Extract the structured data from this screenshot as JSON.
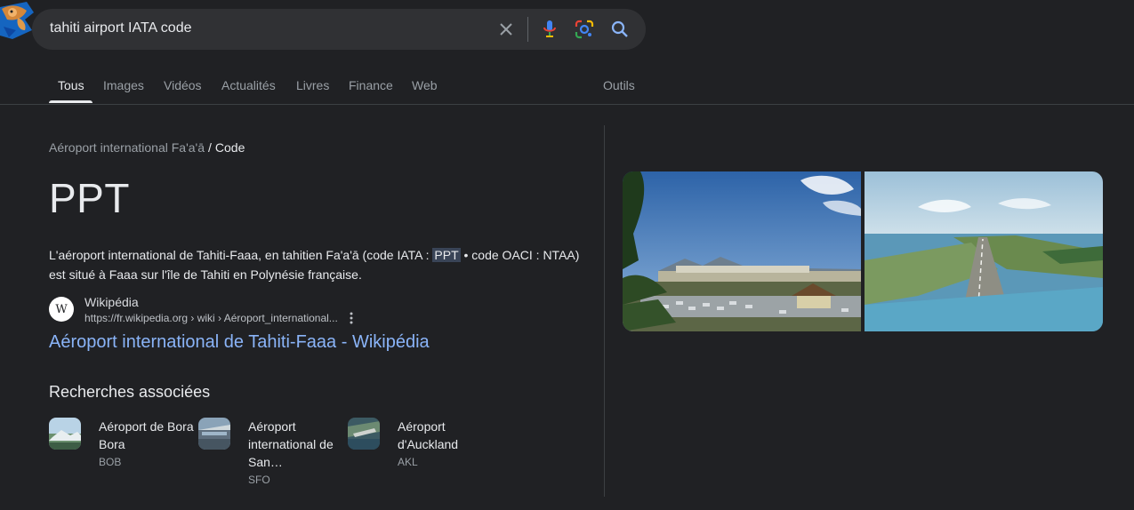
{
  "search": {
    "query": "tahiti airport IATA code"
  },
  "tabs": [
    "Tous",
    "Images",
    "Vidéos",
    "Actualités",
    "Livres",
    "Finance",
    "Web"
  ],
  "tools_label": "Outils",
  "breadcrumb": {
    "parent": "Aéroport international Fa'a'ā",
    "separator": "/",
    "current": "Code"
  },
  "answer": "PPT",
  "snippet": {
    "before": "L'aéroport international de Tahiti-Faaa, en tahitien Fa'a'ā (code IATA : ",
    "highlight": "PPT",
    "after_line1": " • code OACI : NTAA)",
    "line2": "est situé à Faaa sur l'île de Tahiti en Polynésie française."
  },
  "source": {
    "logo_letter": "W",
    "name": "Wikipédia",
    "url": "https://fr.wikipedia.org › wiki › Aéroport_international..."
  },
  "result_title": "Aéroport international de Tahiti-Faaa - Wikipédia",
  "related": {
    "title": "Recherches associées",
    "items": [
      {
        "name": "Aéroport de Bora Bora",
        "code": "BOB"
      },
      {
        "name": "Aéroport international de San…",
        "code": "SFO"
      },
      {
        "name": "Aéroport d'Auckland",
        "code": "AKL"
      }
    ]
  },
  "colors": {
    "background": "#202124",
    "link": "#8ab4f8",
    "highlight": "#394457"
  }
}
